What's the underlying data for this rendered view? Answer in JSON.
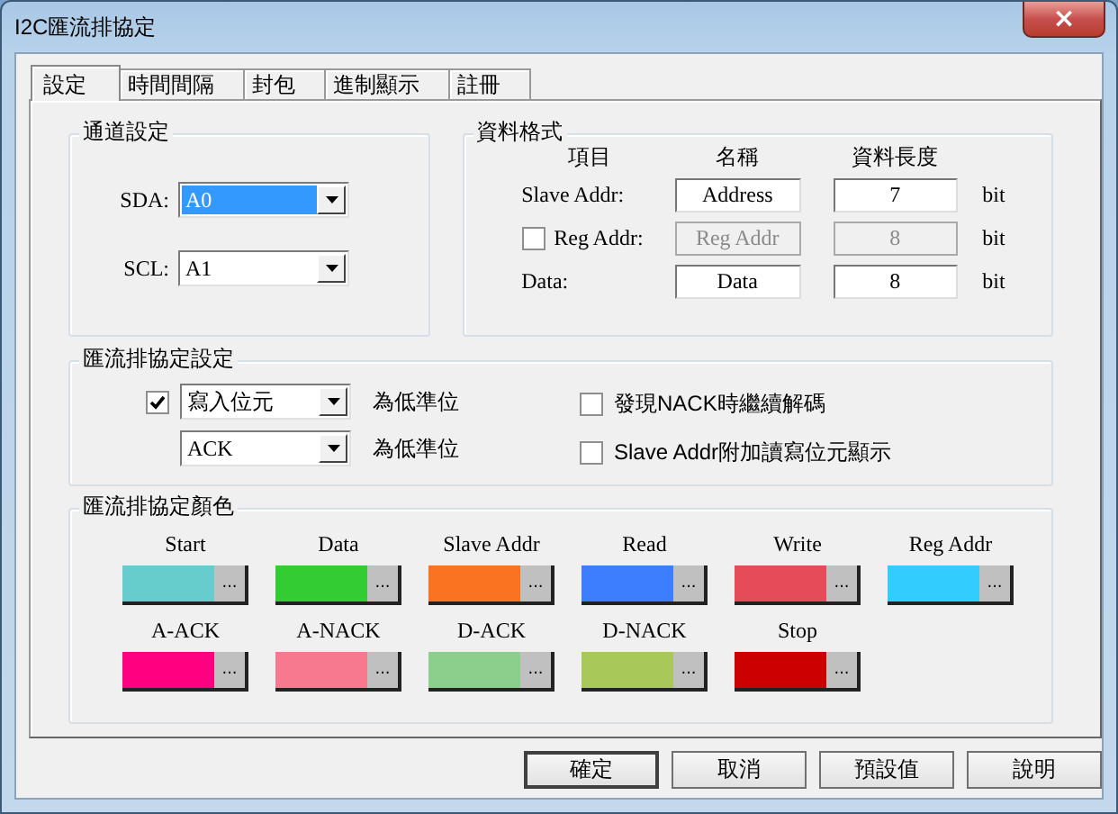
{
  "window": {
    "title": "I2C匯流排協定",
    "close": "×"
  },
  "tabs": [
    {
      "label": "設定",
      "selected": true
    },
    {
      "label": "時間間隔",
      "selected": false
    },
    {
      "label": "封包",
      "selected": false
    },
    {
      "label": "進制顯示",
      "selected": false
    },
    {
      "label": "註冊",
      "selected": false
    }
  ],
  "channel_settings": {
    "title": "通道設定",
    "fields": [
      {
        "label": "SDA:",
        "value": "A0",
        "focused": true
      },
      {
        "label": "SCL:",
        "value": "A1",
        "focused": false
      }
    ]
  },
  "data_format": {
    "title": "資料格式",
    "columns": [
      "項目",
      "名稱",
      "資料長度"
    ],
    "rows": [
      {
        "kind": "plain",
        "label": "Slave Addr:",
        "name": "Address",
        "length": "7",
        "unit": "bit",
        "disabled": false
      },
      {
        "kind": "checkbox",
        "checked": false,
        "label": "Reg Addr:",
        "name": "Reg Addr",
        "length": "8",
        "unit": "bit",
        "disabled": true
      },
      {
        "kind": "plain",
        "label": "Data:",
        "name": "Data",
        "length": "8",
        "unit": "bit",
        "disabled": false
      }
    ]
  },
  "protocol_settings": {
    "title": "匯流排協定設定",
    "low_levels": [
      {
        "kind": "checkbox",
        "checked": true,
        "value": "寫入位元",
        "suffix": "為低準位"
      },
      {
        "kind": "plain",
        "value": "ACK",
        "suffix": "為低準位"
      }
    ],
    "options": [
      {
        "label": "發現NACK時繼續解碼",
        "checked": false
      },
      {
        "label": "Slave Addr附加讀寫位元顯示",
        "checked": false
      }
    ]
  },
  "protocol_colors": {
    "title": "匯流排協定顏色",
    "items": [
      {
        "label": "Start",
        "color": "#66cccc",
        "button": "..."
      },
      {
        "label": "Data",
        "color": "#33cc33",
        "button": "..."
      },
      {
        "label": "Slave Addr",
        "color": "#f97320",
        "button": "..."
      },
      {
        "label": "Read",
        "color": "#3d7eff",
        "button": "..."
      },
      {
        "label": "Write",
        "color": "#e64b5a",
        "button": "..."
      },
      {
        "label": "Reg Addr",
        "color": "#33ccff",
        "button": "..."
      },
      {
        "label": "A-ACK",
        "color": "#ff0080",
        "button": "..."
      },
      {
        "label": "A-NACK",
        "color": "#f77990",
        "button": "..."
      },
      {
        "label": "D-ACK",
        "color": "#8ccf8c",
        "button": "..."
      },
      {
        "label": "D-NACK",
        "color": "#a8c95a",
        "button": "..."
      },
      {
        "label": "Stop",
        "color": "#cc0000",
        "button": "..."
      }
    ]
  },
  "buttons": [
    {
      "label": "確定",
      "default": true
    },
    {
      "label": "取消",
      "default": false
    },
    {
      "label": "預設值",
      "default": false
    },
    {
      "label": "說明",
      "default": false
    }
  ]
}
